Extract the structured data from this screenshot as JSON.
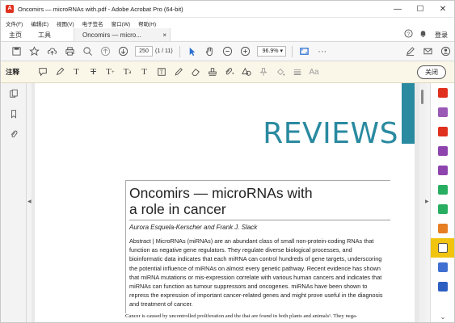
{
  "window": {
    "title": "Oncomirs — microRNAs with.pdf - Adobe Acrobat Pro (64-bit)",
    "app_icon": "acrobat-icon",
    "controls": [
      "—",
      "☐",
      "✕"
    ]
  },
  "menu": [
    "文件(F)",
    "编辑(E)",
    "视图(V)",
    "电子签名",
    "窗口(W)",
    "帮助(H)"
  ],
  "tabs": {
    "home": "主页",
    "tools": "工具",
    "document": "Oncomirs — micro...",
    "close": "×"
  },
  "header_right": {
    "help_icon": "?",
    "bell_icon": "🔔",
    "login": "登录"
  },
  "toolbar": {
    "page_number": "250",
    "page_count": "(1 / 11)",
    "zoom": "96.9%"
  },
  "annotation_bar": {
    "label": "注释",
    "close_label": "关闭"
  },
  "document": {
    "banner": "REVIEWS",
    "title_line1": "Oncomirs — microRNAs with",
    "title_line2": "a role in cancer",
    "authors": "Aurora Esquela-Kerscher and Frank J. Slack",
    "abstract": "Abstract | MicroRNAs (miRNAs) are an abundant class of small non-protein-coding RNAs that function as negative gene regulators. They regulate diverse biological processes, and bioinformatic data indicates that each miRNA can control hundreds of gene targets, underscoring the potential influence of miRNAs on almost every genetic pathway. Recent evidence has shown that miRNA mutations or mis-expression correlate with various human cancers and indicates that miRNAs can function as tumour suppressors and oncogenes. miRNAs have been shown to repress the expression of important cancer-related genes and might prove useful in the diagnosis and treatment of cancer.",
    "body_start": "Cancer is caused by uncontrolled proliferation and the     that are found in both plants and animals¹. They nega-"
  },
  "colors": {
    "accent": "#2a8aa0",
    "annotation_bg": "#fbf7e8",
    "active_tool": "#f1c40f"
  },
  "right_tools": [
    {
      "name": "export-pdf-icon",
      "color": "#e0301e"
    },
    {
      "name": "edit-pdf-icon",
      "color": "#9b59b6"
    },
    {
      "name": "create-pdf-icon",
      "color": "#e0301e"
    },
    {
      "name": "request-signature-icon",
      "color": "#8e44ad"
    },
    {
      "name": "fill-sign-icon",
      "color": "#8e44ad"
    },
    {
      "name": "send-track-icon",
      "color": "#27ae60"
    },
    {
      "name": "organize-pages-icon",
      "color": "#27ae60"
    },
    {
      "name": "compress-icon",
      "color": "#e67e22"
    },
    {
      "name": "comment-icon",
      "color": "#f1c40f"
    },
    {
      "name": "protect-icon",
      "color": "#3f6fd1"
    },
    {
      "name": "shield-icon",
      "color": "#2c5fc2"
    }
  ]
}
